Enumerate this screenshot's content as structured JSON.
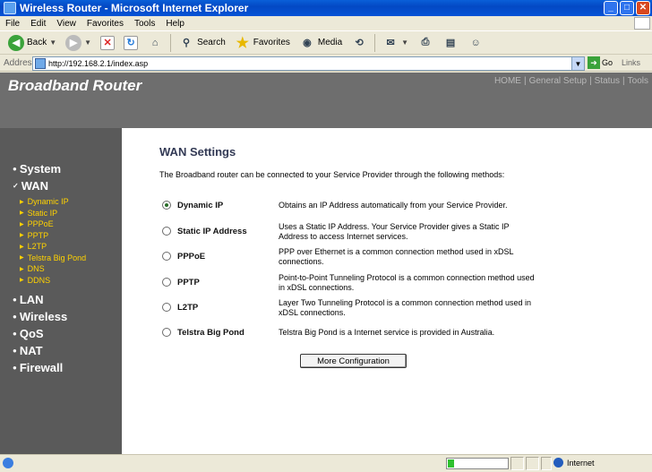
{
  "window": {
    "title": "Wireless Router - Microsoft Internet Explorer",
    "minimize": "_",
    "maximize": "□",
    "close": "✕"
  },
  "menu": [
    "File",
    "Edit",
    "View",
    "Favorites",
    "Tools",
    "Help"
  ],
  "toolbar": {
    "back": "Back",
    "search": "Search",
    "favorites": "Favorites",
    "media": "Media"
  },
  "address": {
    "label": "Address",
    "url": "http://192.168.2.1/index.asp",
    "go": "Go",
    "links": "Links"
  },
  "header": {
    "brand": "Broadband Router",
    "nav": [
      "HOME",
      "General Setup",
      "Status",
      "Tools"
    ],
    "separator": "|"
  },
  "sidebar": {
    "main": [
      {
        "label": "System",
        "marker": "●"
      },
      {
        "label": "WAN",
        "marker": "✓"
      },
      {
        "label": "LAN",
        "marker": "●"
      },
      {
        "label": "Wireless",
        "marker": "●"
      },
      {
        "label": "QoS",
        "marker": "●"
      },
      {
        "label": "NAT",
        "marker": "●"
      },
      {
        "label": "Firewall",
        "marker": "●"
      }
    ],
    "wan_sub": [
      "Dynamic IP",
      "Static IP",
      "PPPoE",
      "PPTP",
      "L2TP",
      "Telstra Big Pond",
      "DNS",
      "DDNS"
    ],
    "sub_marker": "▶"
  },
  "content": {
    "heading": "WAN Settings",
    "intro": "The Broadband router can be connected to your Service Provider through the following methods:",
    "options": [
      {
        "label": "Dynamic IP",
        "desc": "Obtains an IP Address automatically from your Service Provider.",
        "selected": true
      },
      {
        "label": "Static IP Address",
        "desc": "Uses a Static IP Address. Your Service Provider gives a Static IP Address to access Internet services.",
        "selected": false
      },
      {
        "label": "PPPoE",
        "desc": "PPP over Ethernet is a common connection method used in xDSL connections.",
        "selected": false
      },
      {
        "label": "PPTP",
        "desc": "Point-to-Point Tunneling Protocol is a common connection method used in xDSL connections.",
        "selected": false
      },
      {
        "label": "L2TP",
        "desc": "Layer Two Tunneling Protocol is a common connection method used in xDSL connections.",
        "selected": false
      },
      {
        "label": "Telstra Big Pond",
        "desc": "Telstra Big Pond is a Internet service is provided in Australia.",
        "selected": false
      }
    ],
    "more_button": "More Configuration"
  },
  "status": {
    "zone": "Internet",
    "progress": 0.1
  }
}
